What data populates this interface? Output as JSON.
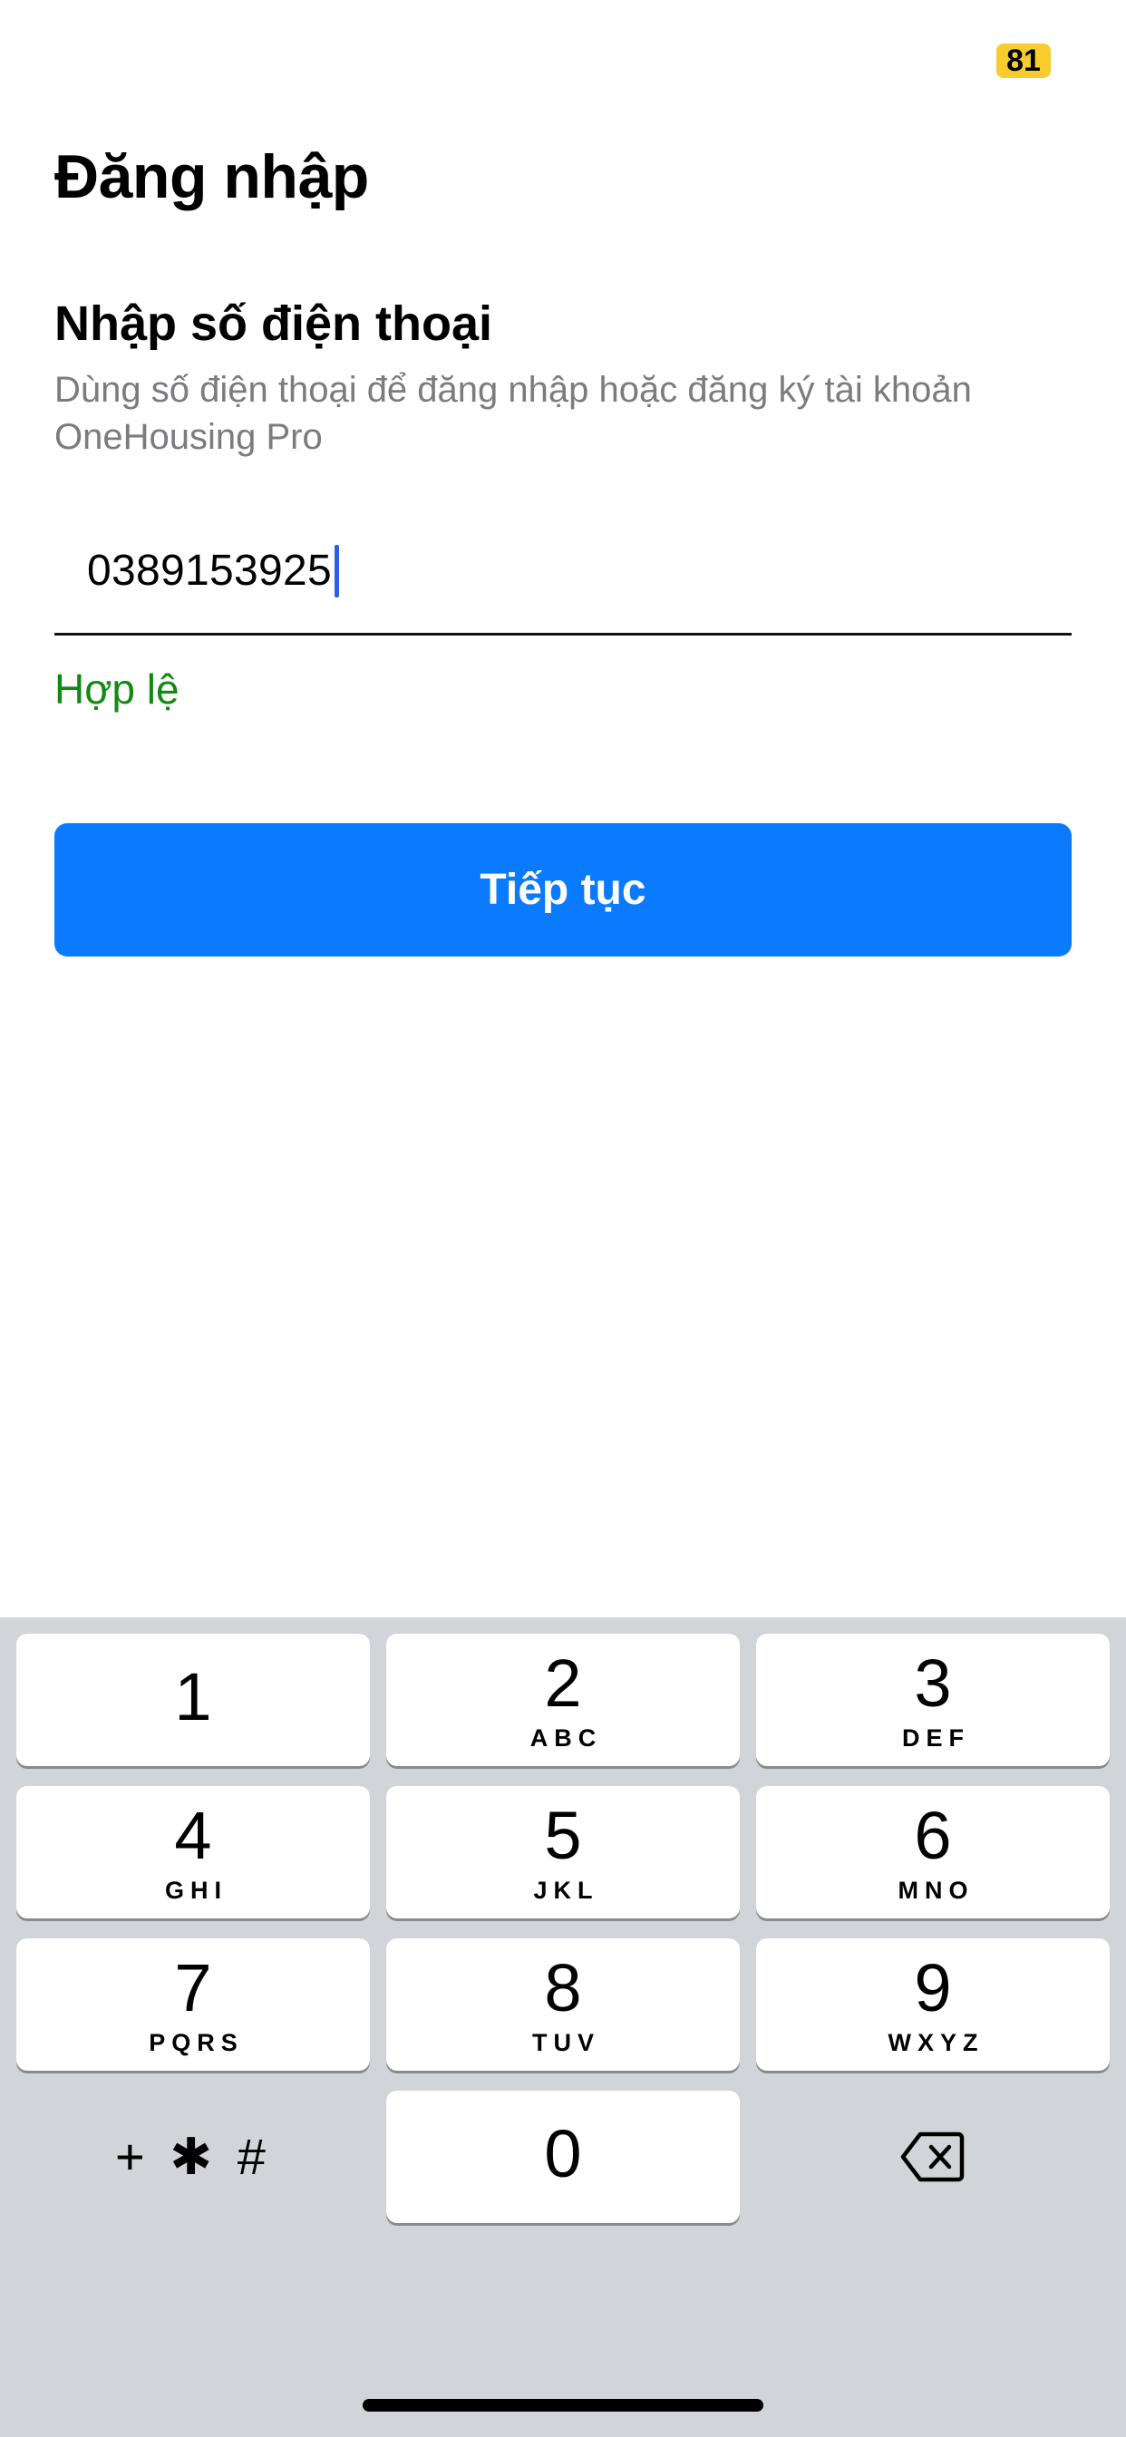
{
  "status_bar": {
    "battery": "81"
  },
  "header": {
    "title": "Đăng nhập"
  },
  "form": {
    "section_title": "Nhập số điện thoại",
    "subtitle": "Dùng số điện thoại để đăng nhập hoặc đăng ký tài khoản OneHousing Pro",
    "phone_value": "0389153925",
    "validation_text": "Hợp lệ",
    "validation_color": "#128a12",
    "continue_label": "Tiếp tục",
    "accent_color": "#0a7aff"
  },
  "keyboard": {
    "keys": [
      {
        "digit": "1",
        "letters": ""
      },
      {
        "digit": "2",
        "letters": "ABC"
      },
      {
        "digit": "3",
        "letters": "DEF"
      },
      {
        "digit": "4",
        "letters": "GHI"
      },
      {
        "digit": "5",
        "letters": "JKL"
      },
      {
        "digit": "6",
        "letters": "MNO"
      },
      {
        "digit": "7",
        "letters": "PQRS"
      },
      {
        "digit": "8",
        "letters": "TUV"
      },
      {
        "digit": "9",
        "letters": "WXYZ"
      },
      {
        "digit": "0",
        "letters": ""
      }
    ],
    "symbols_label": "+ ✱ #",
    "delete_icon": "backspace-icon"
  }
}
